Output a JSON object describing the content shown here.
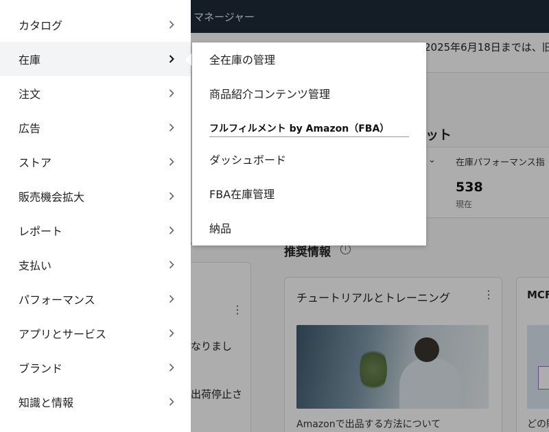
{
  "background": {
    "topbar_title": "マネージャー",
    "notice_text": "2025年6月18日までは、旧",
    "section_title": "ット",
    "performance": {
      "label": "在庫パフォーマンス指",
      "value": "538",
      "sub": "現在"
    },
    "left_card": {
      "text1": "なりまし",
      "text2": "出荷停止さ"
    },
    "recommendations": {
      "title": "推奨情報",
      "info_glyph": "i"
    },
    "tutorial_card": {
      "title": "チュートリアルとトレーニング",
      "caption": "Amazonで出品する方法について"
    },
    "mcf_card": {
      "title": "MCF",
      "caption": "どの販"
    },
    "kebab_glyph": "⋮",
    "chevron_glyph": "⌄"
  },
  "nav": {
    "items": [
      {
        "label": "カタログ"
      },
      {
        "label": "在庫"
      },
      {
        "label": "注文"
      },
      {
        "label": "広告"
      },
      {
        "label": "ストア"
      },
      {
        "label": "販売機会拡大"
      },
      {
        "label": "レポート"
      },
      {
        "label": "支払い"
      },
      {
        "label": "パフォーマンス"
      },
      {
        "label": "アプリとサービス"
      },
      {
        "label": "ブランド"
      },
      {
        "label": "知識と情報"
      }
    ],
    "active_index": 1
  },
  "flyout": {
    "items": [
      {
        "label": "全在庫の管理"
      },
      {
        "label": "商品紹介コンテンツ管理"
      }
    ],
    "section_header": "フルフィルメント by Amazon（FBA）",
    "section_items": [
      {
        "label": "ダッシュボード"
      },
      {
        "label": "FBA在庫管理"
      },
      {
        "label": "納品"
      }
    ]
  },
  "colors": {
    "topbar": "#1e2b37",
    "active_bg": "#f2f4f5",
    "overlay": "rgba(0,0,0,0.32)"
  }
}
